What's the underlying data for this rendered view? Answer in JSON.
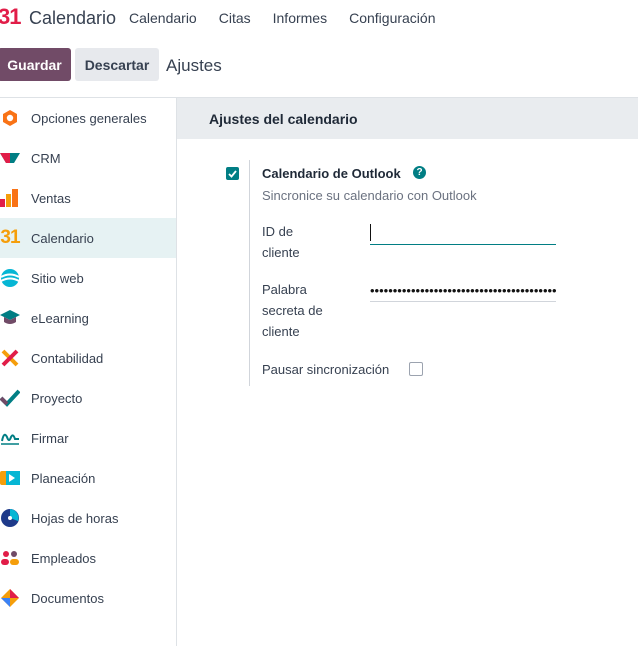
{
  "topbar": {
    "logo": "31",
    "app_name": "Calendario",
    "menu": [
      "Calendario",
      "Citas",
      "Informes",
      "Configuración"
    ]
  },
  "control": {
    "save_label": "Guardar",
    "discard_label": "Descartar",
    "breadcrumb": "Ajustes"
  },
  "sidebar": {
    "items": [
      {
        "label": "Opciones generales",
        "icon": "general-settings-icon"
      },
      {
        "label": "CRM",
        "icon": "crm-icon"
      },
      {
        "label": "Ventas",
        "icon": "sales-icon"
      },
      {
        "label": "Calendario",
        "icon": "calendar-icon",
        "active": true
      },
      {
        "label": "Sitio web",
        "icon": "website-icon"
      },
      {
        "label": "eLearning",
        "icon": "elearning-icon"
      },
      {
        "label": "Contabilidad",
        "icon": "accounting-icon"
      },
      {
        "label": "Proyecto",
        "icon": "project-icon"
      },
      {
        "label": "Firmar",
        "icon": "sign-icon"
      },
      {
        "label": "Planeación",
        "icon": "planning-icon"
      },
      {
        "label": "Hojas de horas",
        "icon": "timesheets-icon"
      },
      {
        "label": "Empleados",
        "icon": "employees-icon"
      },
      {
        "label": "Documentos",
        "icon": "documents-icon"
      }
    ]
  },
  "section": {
    "title": "Ajustes del calendario",
    "setting": {
      "title": "Calendario de Outlook",
      "help": "?",
      "description": "Sincronice su calendario con Outlook",
      "enabled": true,
      "client_id_label": [
        "ID de",
        "cliente"
      ],
      "client_id_value": "",
      "secret_label": [
        "Palabra",
        "secreta de",
        "cliente"
      ],
      "secret_value": "••••••••••••••••••••••••••••••••••••••••••••",
      "pause_label": "Pausar sincronización",
      "pause_checked": false
    }
  },
  "colors": {
    "primary": "#714B67",
    "accent": "#017e84"
  }
}
